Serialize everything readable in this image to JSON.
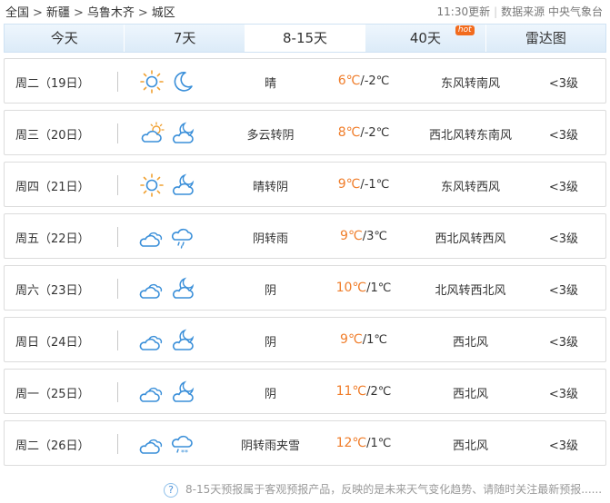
{
  "breadcrumb": {
    "items": [
      "全国",
      "新疆",
      "乌鲁木齐",
      "城区"
    ],
    "separator": ">"
  },
  "meta": {
    "update": "11:30更新",
    "source": "数据来源 中央气象台"
  },
  "tabs": [
    {
      "label": "今天",
      "active": false
    },
    {
      "label": "7天",
      "active": false
    },
    {
      "label": "8-15天",
      "active": true
    },
    {
      "label": "40天",
      "active": false,
      "badge": "hot"
    },
    {
      "label": "雷达图",
      "active": false
    }
  ],
  "forecast": [
    {
      "day": "周二（19日）",
      "icons": [
        "sun",
        "moon"
      ],
      "desc": "晴",
      "high": "6℃",
      "low": "-2℃",
      "wind": "东风转南风",
      "level": "<3级"
    },
    {
      "day": "周三（20日）",
      "icons": [
        "partly-cloudy-day",
        "partly-cloudy-night"
      ],
      "desc": "多云转阴",
      "high": "8℃",
      "low": "-2℃",
      "wind": "西北风转东南风",
      "level": "<3级"
    },
    {
      "day": "周四（21日）",
      "icons": [
        "sun",
        "partly-cloudy-night"
      ],
      "desc": "晴转阴",
      "high": "9℃",
      "low": "-1℃",
      "wind": "东风转西风",
      "level": "<3级"
    },
    {
      "day": "周五（22日）",
      "icons": [
        "overcast",
        "rain"
      ],
      "desc": "阴转雨",
      "high": "9℃",
      "low": "3℃",
      "wind": "西北风转西风",
      "level": "<3级"
    },
    {
      "day": "周六（23日）",
      "icons": [
        "overcast",
        "partly-cloudy-night"
      ],
      "desc": "阴",
      "high": "10℃",
      "low": "1℃",
      "wind": "北风转西北风",
      "level": "<3级"
    },
    {
      "day": "周日（24日）",
      "icons": [
        "overcast",
        "partly-cloudy-night"
      ],
      "desc": "阴",
      "high": "9℃",
      "low": "1℃",
      "wind": "西北风",
      "level": "<3级"
    },
    {
      "day": "周一（25日）",
      "icons": [
        "overcast",
        "partly-cloudy-night"
      ],
      "desc": "阴",
      "high": "11℃",
      "low": "2℃",
      "wind": "西北风",
      "level": "<3级"
    },
    {
      "day": "周二（26日）",
      "icons": [
        "overcast",
        "sleet"
      ],
      "desc": "阴转雨夹雪",
      "high": "12℃",
      "low": "1℃",
      "wind": "西北风",
      "level": "<3级"
    }
  ],
  "footer": {
    "icon": "question-icon",
    "text": "8-15天预报属于客观预报产品，反映的是未来天气变化趋势、请随时关注最新预报......"
  },
  "colors": {
    "accent": "#f07d2a",
    "icon_blue": "#3a8fd9",
    "icon_orange": "#f0a030"
  }
}
